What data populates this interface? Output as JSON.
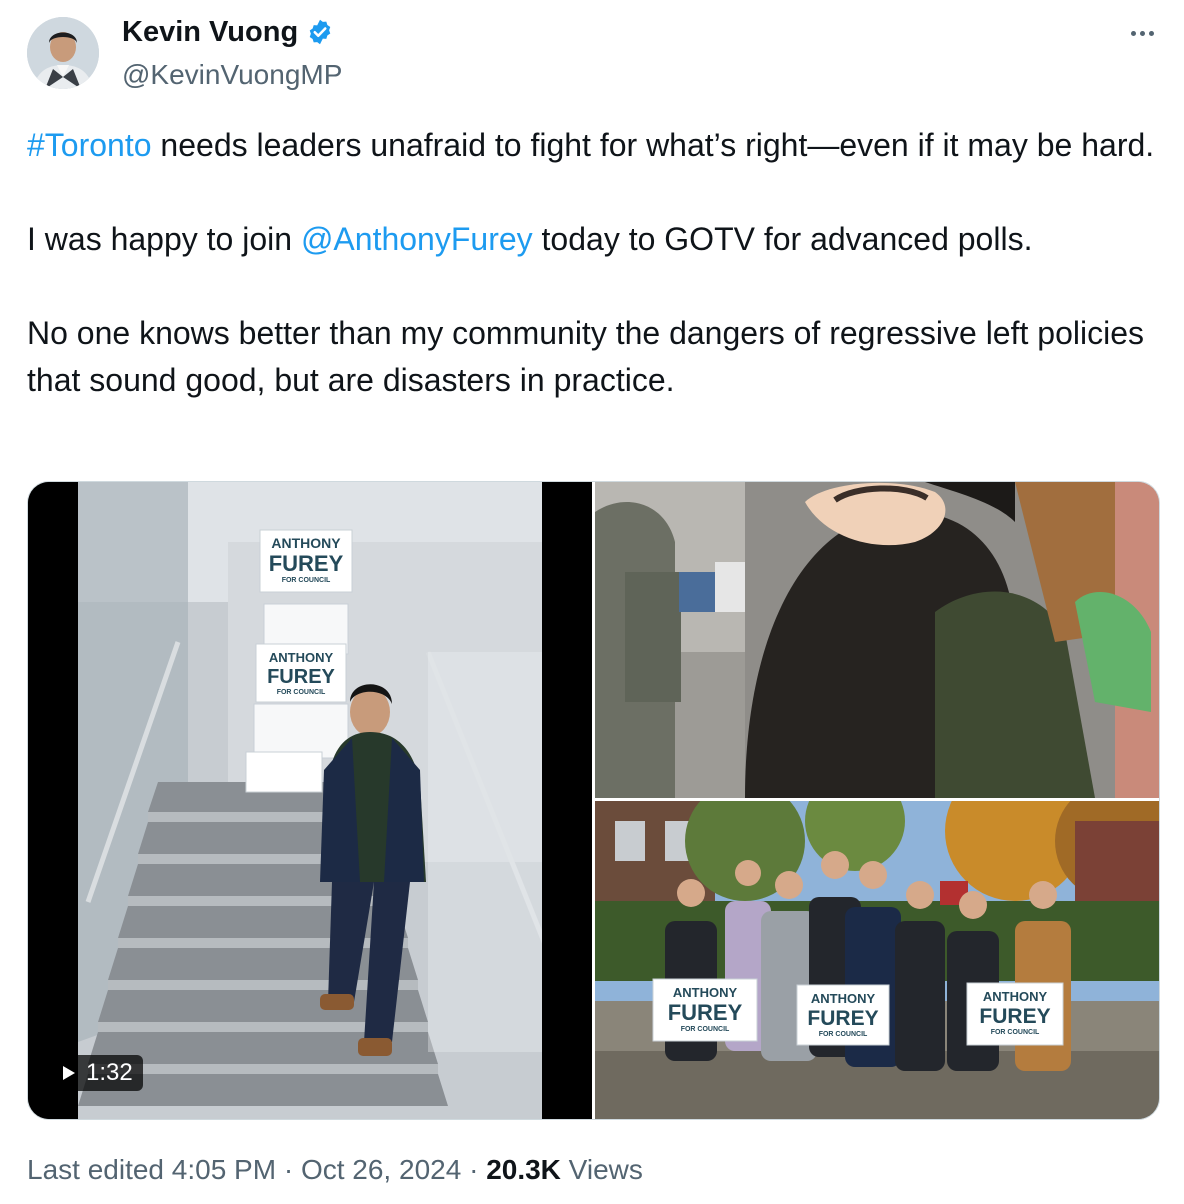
{
  "author": {
    "name": "Kevin Vuong",
    "handle": "@KevinVuongMP",
    "verified_color": "#1d9bf0"
  },
  "tweet": {
    "hashtag": "#Toronto",
    "line1_rest": " needs leaders unafraid to fight for what’s right—even if it may be hard.",
    "line2_pre": "I was happy to join ",
    "mention": "@AnthonyFurey",
    "line2_post": " today to GOTV for advanced polls.",
    "line3": "No one knows better than my community the dangers of regressive left policies that sound good, but are disasters in practice."
  },
  "video": {
    "duration": "1:32"
  },
  "signs": {
    "first": "ANTHONY",
    "last": "FUREY",
    "sub": "FOR COUNCIL"
  },
  "footer": {
    "edited_label": "Last edited",
    "time": "4:05 PM",
    "sep1": " · ",
    "date": "Oct 26, 2024",
    "sep2": " · ",
    "views_count": "20.3K",
    "views_label": " Views"
  },
  "more_dots": "…"
}
